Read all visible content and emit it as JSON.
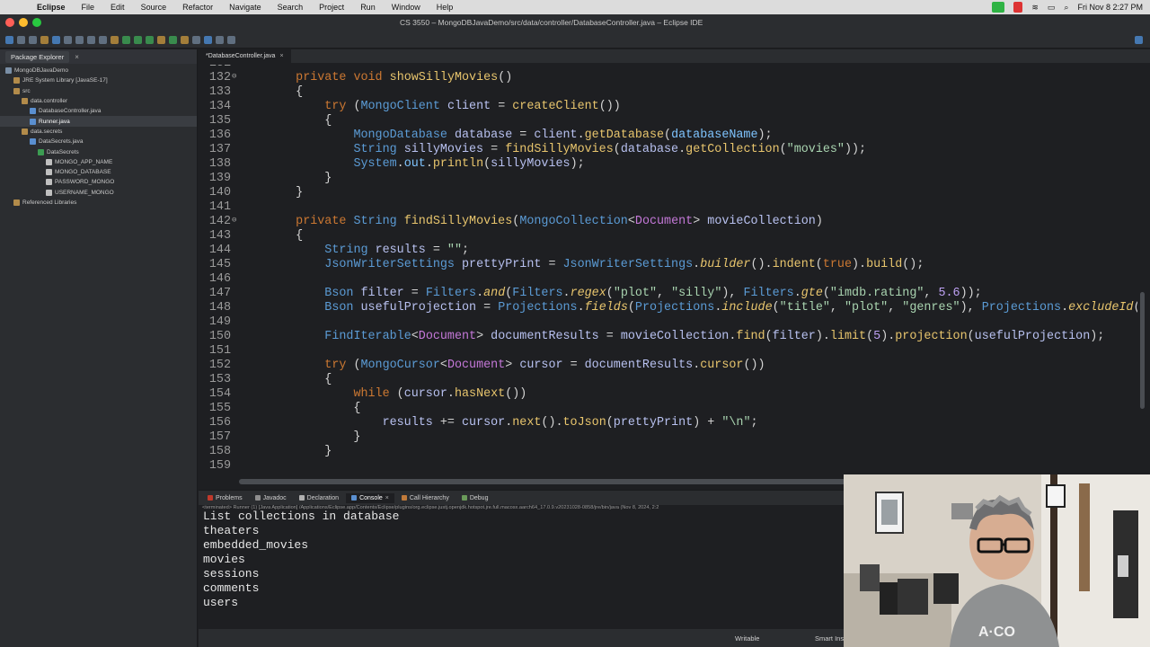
{
  "menubar": {
    "app_name": "Eclipse",
    "items": [
      "File",
      "Edit",
      "Source",
      "Refactor",
      "Navigate",
      "Search",
      "Project",
      "Run",
      "Window",
      "Help"
    ],
    "window_title": "CS 3550 – MongoDBJavaDemo/src/data/controller/DatabaseController.java – Eclipse IDE",
    "clock": "Fri Nov 8  2:27 PM"
  },
  "explorer": {
    "tab_label": "Package Explorer",
    "tree": [
      {
        "label": "MongoDBJavaDemo",
        "indent": 0,
        "color": "#7a8fa6"
      },
      {
        "label": "JRE System Library [JavaSE-17]",
        "indent": 1,
        "color": "#b28b4a"
      },
      {
        "label": "src",
        "indent": 1,
        "color": "#b28b4a"
      },
      {
        "label": "data.controller",
        "indent": 2,
        "color": "#b28b4a"
      },
      {
        "label": "DatabaseController.java",
        "indent": 3,
        "color": "#5a8fd0"
      },
      {
        "label": "Runner.java",
        "indent": 3,
        "color": "#5a8fd0",
        "selected": true
      },
      {
        "label": "data.secrets",
        "indent": 2,
        "color": "#b28b4a"
      },
      {
        "label": "DataSecrets.java",
        "indent": 3,
        "color": "#5a8fd0"
      },
      {
        "label": "DataSecrets",
        "indent": 4,
        "color": "#3c9c52"
      },
      {
        "label": "MONGO_APP_NAME",
        "indent": 5,
        "color": "#c0c0c0"
      },
      {
        "label": "MONGO_DATABASE",
        "indent": 5,
        "color": "#c0c0c0"
      },
      {
        "label": "PASSWORD_MONGO",
        "indent": 5,
        "color": "#c0c0c0"
      },
      {
        "label": "USERNAME_MONGO",
        "indent": 5,
        "color": "#c0c0c0"
      },
      {
        "label": "Referenced Libraries",
        "indent": 1,
        "color": "#b28b4a"
      }
    ]
  },
  "editor": {
    "tab_label": "*DatabaseController.java",
    "lines": [
      {
        "n": "131",
        "mk": "",
        "t": [
          [
            "pl",
            ""
          ]
        ]
      },
      {
        "n": "132",
        "mk": "⊖",
        "t": [
          [
            "pl",
            "    "
          ],
          [
            "kw",
            "private"
          ],
          [
            "pl",
            " "
          ],
          [
            "kw",
            "void"
          ],
          [
            "pl",
            " "
          ],
          [
            "mt",
            "showSillyMovies"
          ],
          [
            "pl",
            "()"
          ]
        ]
      },
      {
        "n": "133",
        "mk": "",
        "t": [
          [
            "pl",
            "    {"
          ]
        ]
      },
      {
        "n": "134",
        "mk": "",
        "t": [
          [
            "pl",
            "        "
          ],
          [
            "kw",
            "try"
          ],
          [
            "pl",
            " ("
          ],
          [
            "ty",
            "MongoClient"
          ],
          [
            "pl",
            " "
          ],
          [
            "vr",
            "client"
          ],
          [
            "pl",
            " = "
          ],
          [
            "mt",
            "createClient"
          ],
          [
            "pl",
            "())"
          ]
        ]
      },
      {
        "n": "135",
        "mk": "",
        "t": [
          [
            "pl",
            "        {"
          ]
        ]
      },
      {
        "n": "136",
        "mk": "",
        "t": [
          [
            "pl",
            "            "
          ],
          [
            "ty",
            "MongoDatabase"
          ],
          [
            "pl",
            " "
          ],
          [
            "vr",
            "database"
          ],
          [
            "pl",
            " = "
          ],
          [
            "vr",
            "client"
          ],
          [
            "pl",
            "."
          ],
          [
            "mt",
            "getDatabase"
          ],
          [
            "pl",
            "("
          ],
          [
            "fd",
            "databaseName"
          ],
          [
            "pl",
            ");"
          ]
        ]
      },
      {
        "n": "137",
        "mk": "",
        "t": [
          [
            "pl",
            "            "
          ],
          [
            "ty",
            "String"
          ],
          [
            "pl",
            " "
          ],
          [
            "vr",
            "sillyMovies"
          ],
          [
            "pl",
            " = "
          ],
          [
            "mt",
            "findSillyMovies"
          ],
          [
            "pl",
            "("
          ],
          [
            "vr",
            "database"
          ],
          [
            "pl",
            "."
          ],
          [
            "mt",
            "getCollection"
          ],
          [
            "pl",
            "("
          ],
          [
            "st",
            "\"movies\""
          ],
          [
            "pl",
            "));"
          ]
        ]
      },
      {
        "n": "138",
        "mk": "",
        "t": [
          [
            "pl",
            "            "
          ],
          [
            "ty",
            "System"
          ],
          [
            "pl",
            "."
          ],
          [
            "fd",
            "out"
          ],
          [
            "pl",
            "."
          ],
          [
            "mt",
            "println"
          ],
          [
            "pl",
            "("
          ],
          [
            "vr",
            "sillyMovies"
          ],
          [
            "pl",
            ");"
          ]
        ]
      },
      {
        "n": "139",
        "mk": "",
        "t": [
          [
            "pl",
            "        }"
          ]
        ]
      },
      {
        "n": "140",
        "mk": "",
        "t": [
          [
            "pl",
            "    }"
          ]
        ]
      },
      {
        "n": "141",
        "mk": "",
        "t": [
          [
            "pl",
            ""
          ]
        ]
      },
      {
        "n": "142",
        "mk": "⊖",
        "t": [
          [
            "pl",
            "    "
          ],
          [
            "kw",
            "private"
          ],
          [
            "pl",
            " "
          ],
          [
            "ty",
            "String"
          ],
          [
            "pl",
            " "
          ],
          [
            "mt",
            "findSillyMovies"
          ],
          [
            "pl",
            "("
          ],
          [
            "ty",
            "MongoCollection"
          ],
          [
            "pl",
            "<"
          ],
          [
            "gn",
            "Document"
          ],
          [
            "pl",
            "> "
          ],
          [
            "vr",
            "movieCollection"
          ],
          [
            "pl",
            ")"
          ]
        ]
      },
      {
        "n": "143",
        "mk": "",
        "t": [
          [
            "pl",
            "    {"
          ]
        ]
      },
      {
        "n": "144",
        "mk": "",
        "t": [
          [
            "pl",
            "        "
          ],
          [
            "ty",
            "String"
          ],
          [
            "pl",
            " "
          ],
          [
            "vr",
            "results"
          ],
          [
            "pl",
            " = "
          ],
          [
            "st",
            "\"\""
          ],
          [
            "pl",
            ";"
          ]
        ]
      },
      {
        "n": "145",
        "mk": "",
        "t": [
          [
            "pl",
            "        "
          ],
          [
            "ty",
            "JsonWriterSettings"
          ],
          [
            "pl",
            " "
          ],
          [
            "vr",
            "prettyPrint"
          ],
          [
            "pl",
            " = "
          ],
          [
            "ty",
            "JsonWriterSettings"
          ],
          [
            "pl",
            "."
          ],
          [
            "it",
            "builder"
          ],
          [
            "pl",
            "()."
          ],
          [
            "mt",
            "indent"
          ],
          [
            "pl",
            "("
          ],
          [
            "kw",
            "true"
          ],
          [
            "pl",
            ")."
          ],
          [
            "mt",
            "build"
          ],
          [
            "pl",
            "();"
          ]
        ]
      },
      {
        "n": "146",
        "mk": "",
        "t": [
          [
            "pl",
            ""
          ]
        ]
      },
      {
        "n": "147",
        "mk": "",
        "t": [
          [
            "pl",
            "        "
          ],
          [
            "ty",
            "Bson"
          ],
          [
            "pl",
            " "
          ],
          [
            "vr",
            "filter"
          ],
          [
            "pl",
            " = "
          ],
          [
            "ty",
            "Filters"
          ],
          [
            "pl",
            "."
          ],
          [
            "it",
            "and"
          ],
          [
            "pl",
            "("
          ],
          [
            "ty",
            "Filters"
          ],
          [
            "pl",
            "."
          ],
          [
            "it",
            "regex"
          ],
          [
            "pl",
            "("
          ],
          [
            "st",
            "\"plot\""
          ],
          [
            "pl",
            ", "
          ],
          [
            "st",
            "\"silly\""
          ],
          [
            "pl",
            "), "
          ],
          [
            "ty",
            "Filters"
          ],
          [
            "pl",
            "."
          ],
          [
            "it",
            "gte"
          ],
          [
            "pl",
            "("
          ],
          [
            "st",
            "\"imdb.rating\""
          ],
          [
            "pl",
            ", "
          ],
          [
            "nm",
            "5.6"
          ],
          [
            "pl",
            "));"
          ]
        ]
      },
      {
        "n": "148",
        "mk": "",
        "t": [
          [
            "pl",
            "        "
          ],
          [
            "ty",
            "Bson"
          ],
          [
            "pl",
            " "
          ],
          [
            "vr",
            "usefulProjection"
          ],
          [
            "pl",
            " = "
          ],
          [
            "ty",
            "Projections"
          ],
          [
            "pl",
            "."
          ],
          [
            "it",
            "fields"
          ],
          [
            "pl",
            "("
          ],
          [
            "ty",
            "Projections"
          ],
          [
            "pl",
            "."
          ],
          [
            "it",
            "include"
          ],
          [
            "pl",
            "("
          ],
          [
            "st",
            "\"title\""
          ],
          [
            "pl",
            ", "
          ],
          [
            "st",
            "\"plot\""
          ],
          [
            "pl",
            ", "
          ],
          [
            "st",
            "\"genres\""
          ],
          [
            "pl",
            "), "
          ],
          [
            "ty",
            "Projections"
          ],
          [
            "pl",
            "."
          ],
          [
            "it",
            "excludeId"
          ],
          [
            "pl",
            "());"
          ]
        ]
      },
      {
        "n": "149",
        "mk": "",
        "t": [
          [
            "pl",
            ""
          ]
        ]
      },
      {
        "n": "150",
        "mk": "",
        "t": [
          [
            "pl",
            "        "
          ],
          [
            "ty",
            "FindIterable"
          ],
          [
            "pl",
            "<"
          ],
          [
            "gn",
            "Document"
          ],
          [
            "pl",
            "> "
          ],
          [
            "vr",
            "documentResults"
          ],
          [
            "pl",
            " = "
          ],
          [
            "vr",
            "movieCollection"
          ],
          [
            "pl",
            "."
          ],
          [
            "mt",
            "find"
          ],
          [
            "pl",
            "("
          ],
          [
            "vr",
            "filter"
          ],
          [
            "pl",
            ")."
          ],
          [
            "mt",
            "limit"
          ],
          [
            "pl",
            "("
          ],
          [
            "nm",
            "5"
          ],
          [
            "pl",
            ")."
          ],
          [
            "mt",
            "projection"
          ],
          [
            "pl",
            "("
          ],
          [
            "vr",
            "usefulProjection"
          ],
          [
            "pl",
            ");"
          ]
        ]
      },
      {
        "n": "151",
        "mk": "",
        "t": [
          [
            "pl",
            ""
          ]
        ]
      },
      {
        "n": "152",
        "mk": "",
        "t": [
          [
            "pl",
            "        "
          ],
          [
            "kw",
            "try"
          ],
          [
            "pl",
            " ("
          ],
          [
            "ty",
            "MongoCursor"
          ],
          [
            "pl",
            "<"
          ],
          [
            "gn",
            "Document"
          ],
          [
            "pl",
            "> "
          ],
          [
            "vr",
            "cursor"
          ],
          [
            "pl",
            " = "
          ],
          [
            "vr",
            "documentResults"
          ],
          [
            "pl",
            "."
          ],
          [
            "mt",
            "cursor"
          ],
          [
            "pl",
            "())"
          ]
        ]
      },
      {
        "n": "153",
        "mk": "",
        "t": [
          [
            "pl",
            "        {"
          ]
        ]
      },
      {
        "n": "154",
        "mk": "",
        "t": [
          [
            "pl",
            "            "
          ],
          [
            "kw",
            "while"
          ],
          [
            "pl",
            " ("
          ],
          [
            "vr",
            "cursor"
          ],
          [
            "pl",
            "."
          ],
          [
            "mt",
            "hasNext"
          ],
          [
            "pl",
            "())"
          ]
        ]
      },
      {
        "n": "155",
        "mk": "",
        "t": [
          [
            "pl",
            "            {"
          ]
        ]
      },
      {
        "n": "156",
        "mk": "",
        "t": [
          [
            "pl",
            "                "
          ],
          [
            "vr",
            "results"
          ],
          [
            "pl",
            " += "
          ],
          [
            "vr",
            "cursor"
          ],
          [
            "pl",
            "."
          ],
          [
            "mt",
            "next"
          ],
          [
            "pl",
            "()."
          ],
          [
            "mt",
            "toJson"
          ],
          [
            "pl",
            "("
          ],
          [
            "vr",
            "prettyPrint"
          ],
          [
            "pl",
            ") + "
          ],
          [
            "st",
            "\"\\n\""
          ],
          [
            "pl",
            ";"
          ]
        ]
      },
      {
        "n": "157",
        "mk": "",
        "t": [
          [
            "pl",
            "            }"
          ]
        ]
      },
      {
        "n": "158",
        "mk": "",
        "t": [
          [
            "pl",
            "        }"
          ]
        ]
      },
      {
        "n": "159",
        "mk": "",
        "t": [
          [
            "pl",
            ""
          ]
        ]
      }
    ]
  },
  "console": {
    "tabs": [
      {
        "label": "Problems",
        "active": false
      },
      {
        "label": "Javadoc",
        "active": false
      },
      {
        "label": "Declaration",
        "active": false
      },
      {
        "label": "Console",
        "active": true
      },
      {
        "label": "Call Hierarchy",
        "active": false
      },
      {
        "label": "Debug",
        "active": false
      }
    ],
    "terminated": "<terminated> Runner (1) [Java Application] /Applications/Eclipse.app/Contents/Eclipse/plugins/org.eclipse.justj.openjdk.hotspot.jre.full.macosx.aarch64_17.0.9.v20231028-0858/jre/bin/java  (Nov 8, 2024, 2:2",
    "output": [
      "List collections in database",
      "theaters",
      "embedded_movies",
      "movies",
      "sessions",
      "comments",
      "users"
    ]
  },
  "statusbar": {
    "writable": "Writable",
    "insert_mode": "Smart Inser"
  }
}
